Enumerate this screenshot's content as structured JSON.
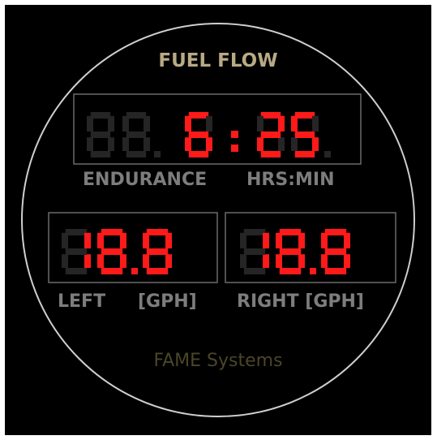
{
  "gauge": {
    "title": "FUEL FLOW",
    "brand": "FAME Systems",
    "colors": {
      "background": "#000000",
      "ring": "#cfcfcf",
      "frame": "#6a6a6a",
      "segment_on": "#ff1a1a",
      "segment_off": "#252525",
      "title": "#b8aa85",
      "label": "#7d7d7d",
      "brand": "#4a4626"
    },
    "endurance": {
      "label": "ENDURANCE",
      "unit": "HRS:MIN",
      "hours": "6",
      "minutes": "25",
      "value": "6:25"
    },
    "left": {
      "label": "LEFT",
      "unit": "[GPH]",
      "value": "18.8"
    },
    "right": {
      "label": "RIGHT [GPH]",
      "value": "18.8"
    }
  }
}
